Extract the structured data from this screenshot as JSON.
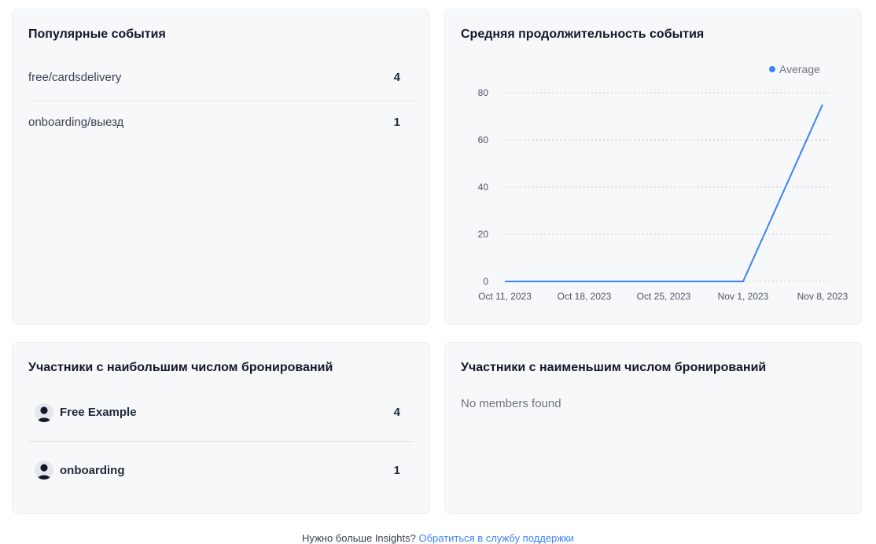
{
  "popular_events": {
    "title": "Популярные события",
    "items": [
      {
        "label": "free/cardsdelivery",
        "count": "4"
      },
      {
        "label": "onboarding/выезд",
        "count": "1"
      }
    ]
  },
  "avg_duration": {
    "title": "Средняя продолжительность события"
  },
  "chart_data": {
    "type": "line",
    "x": [
      "Oct 11, 2023",
      "Oct 18, 2023",
      "Oct 25, 2023",
      "Nov 1, 2023",
      "Nov 8, 2023"
    ],
    "series": [
      {
        "name": "Average",
        "color": "#3b82f6",
        "values": [
          0,
          0,
          0,
          0,
          75
        ]
      }
    ],
    "yticks": [
      0,
      20,
      40,
      60,
      80
    ],
    "ylim": [
      0,
      80
    ],
    "grid": true,
    "legend": "top-right",
    "title": "",
    "xlabel": "",
    "ylabel": ""
  },
  "most_bookings": {
    "title": "Участники с наибольшим числом бронирований",
    "items": [
      {
        "name": "Free Example",
        "count": "4",
        "icon": "user-avatar-icon"
      },
      {
        "name": "onboarding",
        "count": "1",
        "icon": "user-avatar-icon"
      }
    ]
  },
  "least_bookings": {
    "title": "Участники с наименьшим числом бронирований",
    "empty_text": "No members found"
  },
  "footer": {
    "text": "Нужно больше Insights?",
    "link": "Обратиться в службу поддержки"
  },
  "colors": {
    "accent": "#3b82f6",
    "card_bg": "#f7f8fa"
  }
}
